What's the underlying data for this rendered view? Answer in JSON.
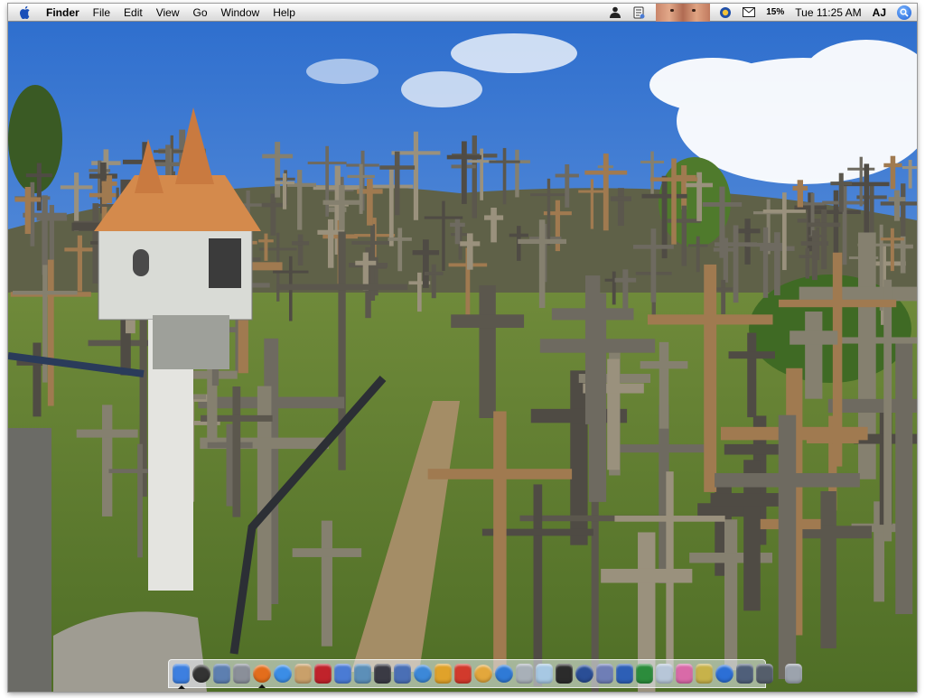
{
  "menubar": {
    "app_name": "Finder",
    "menus": [
      "File",
      "Edit",
      "View",
      "Go",
      "Window",
      "Help"
    ],
    "battery": "15%",
    "clock": "Tue 11:25 AM",
    "user": "AJ"
  },
  "dock": {
    "apps": [
      {
        "name": "finder",
        "color": "#3d7fe0",
        "running": true
      },
      {
        "name": "dashboard",
        "color": "#333333",
        "round": true
      },
      {
        "name": "mail",
        "color": "#5d7fb0"
      },
      {
        "name": "system-preferences",
        "color": "#8a8f99"
      },
      {
        "name": "firefox",
        "color": "#e36d1c",
        "round": true,
        "running": true
      },
      {
        "name": "ichat",
        "color": "#3b8de6",
        "round": true
      },
      {
        "name": "address-book",
        "color": "#c9a06a"
      },
      {
        "name": "acrobat",
        "color": "#c0232b"
      },
      {
        "name": "itunes",
        "color": "#4a7bd4"
      },
      {
        "name": "iphoto",
        "color": "#5c8fb8"
      },
      {
        "name": "imovie",
        "color": "#3a3a44"
      },
      {
        "name": "idvd",
        "color": "#4a6fb5"
      },
      {
        "name": "safari",
        "color": "#3c88d8",
        "round": true
      },
      {
        "name": "garageband",
        "color": "#e0a22a"
      },
      {
        "name": "ical",
        "color": "#d23a2c"
      },
      {
        "name": "sync",
        "color": "#e3a73c",
        "round": true
      },
      {
        "name": "quicktime",
        "color": "#2f7ad6",
        "round": true
      },
      {
        "name": "image-capture",
        "color": "#a8b0b8"
      },
      {
        "name": "preview",
        "color": "#a7c8e3"
      },
      {
        "name": "terminal",
        "color": "#2b2b2b"
      },
      {
        "name": "cyberduck",
        "color": "#2a4e96",
        "round": true
      },
      {
        "name": "photoshop",
        "color": "#6f7eb6"
      },
      {
        "name": "word",
        "color": "#2d5fb6"
      },
      {
        "name": "excel",
        "color": "#2c8c3c"
      },
      {
        "name": "itunes-store",
        "color": "#b7c6d8"
      },
      {
        "name": "flower-app",
        "color": "#d96aa8"
      },
      {
        "name": "widgets",
        "color": "#c7b24a"
      },
      {
        "name": "bluetooth",
        "color": "#2c6fd6",
        "round": true
      },
      {
        "name": "display-settings",
        "color": "#4f5f7a"
      },
      {
        "name": "network-monitor",
        "color": "#555e6b"
      }
    ],
    "trash": {
      "name": "trash",
      "color": "#9ca3ad"
    }
  }
}
